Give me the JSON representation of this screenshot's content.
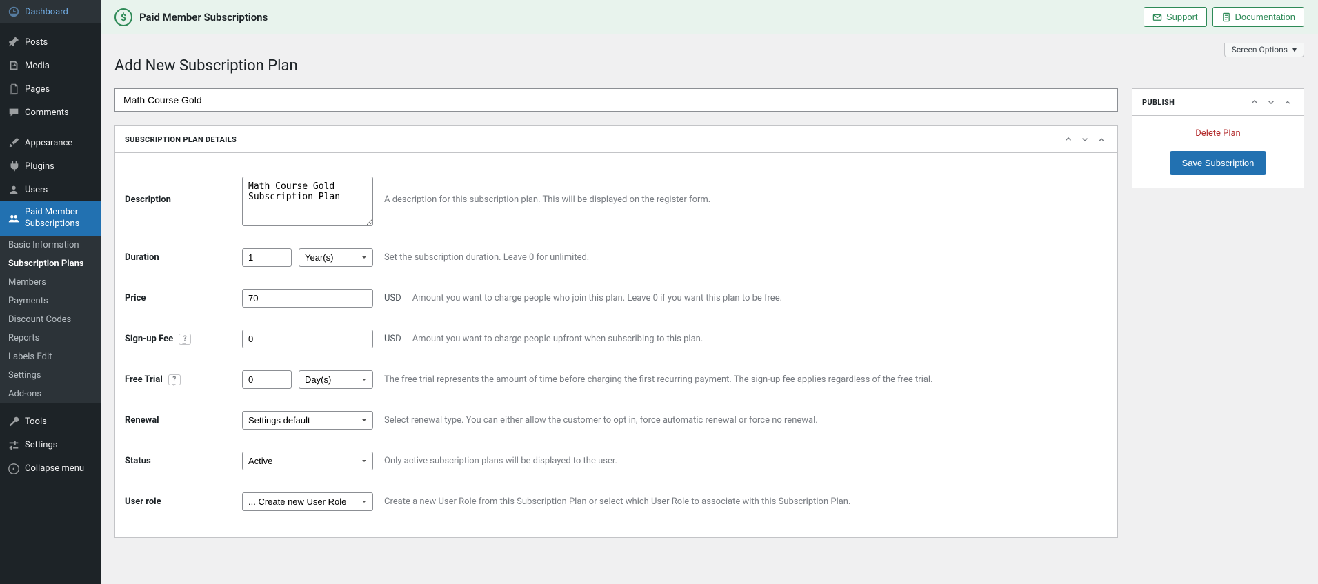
{
  "sidebar": {
    "dashboard": "Dashboard",
    "posts": "Posts",
    "media": "Media",
    "pages": "Pages",
    "comments": "Comments",
    "appearance": "Appearance",
    "plugins": "Plugins",
    "users": "Users",
    "paid_member": "Paid Member",
    "subscriptions": "Subscriptions",
    "tools": "Tools",
    "settings": "Settings",
    "collapse": "Collapse menu",
    "sub": {
      "basic_info": "Basic Information",
      "subscription_plans": "Subscription Plans",
      "members": "Members",
      "payments": "Payments",
      "discount_codes": "Discount Codes",
      "reports": "Reports",
      "labels_edit": "Labels Edit",
      "settings": "Settings",
      "addons": "Add-ons"
    }
  },
  "topbar": {
    "title": "Paid Member Subscriptions",
    "support": "Support",
    "documentation": "Documentation"
  },
  "page": {
    "screen_options": "Screen Options",
    "heading": "Add New Subscription Plan",
    "plan_title": "Math Course Gold"
  },
  "details": {
    "panel_title": "Subscription Plan Details",
    "description_label": "Description",
    "description_value": "Math Course Gold Subscription Plan",
    "description_help": "A description for this subscription plan. This will be displayed on the register form.",
    "duration_label": "Duration",
    "duration_value": "1",
    "duration_unit": "Year(s)",
    "duration_help": "Set the subscription duration. Leave 0 for unlimited.",
    "price_label": "Price",
    "price_value": "70",
    "price_unit": "USD",
    "price_help": "Amount you want to charge people who join this plan. Leave 0 if you want this plan to be free.",
    "signup_label": "Sign-up Fee",
    "signup_value": "0",
    "signup_unit": "USD",
    "signup_help": "Amount you want to charge people upfront when subscribing to this plan.",
    "trial_label": "Free Trial",
    "trial_value": "0",
    "trial_unit": "Day(s)",
    "trial_help": "The free trial represents the amount of time before charging the first recurring payment. The sign-up fee applies regardless of the free trial.",
    "renewal_label": "Renewal",
    "renewal_value": "Settings default",
    "renewal_help": "Select renewal type. You can either allow the customer to opt in, force automatic renewal or force no renewal.",
    "status_label": "Status",
    "status_value": "Active",
    "status_help": "Only active subscription plans will be displayed to the user.",
    "role_label": "User role",
    "role_value": "... Create new User Role",
    "role_help": "Create a new User Role from this Subscription Plan or select which User Role to associate with this Subscription Plan."
  },
  "publish": {
    "panel_title": "Publish",
    "delete": "Delete Plan",
    "save": "Save Subscription"
  }
}
